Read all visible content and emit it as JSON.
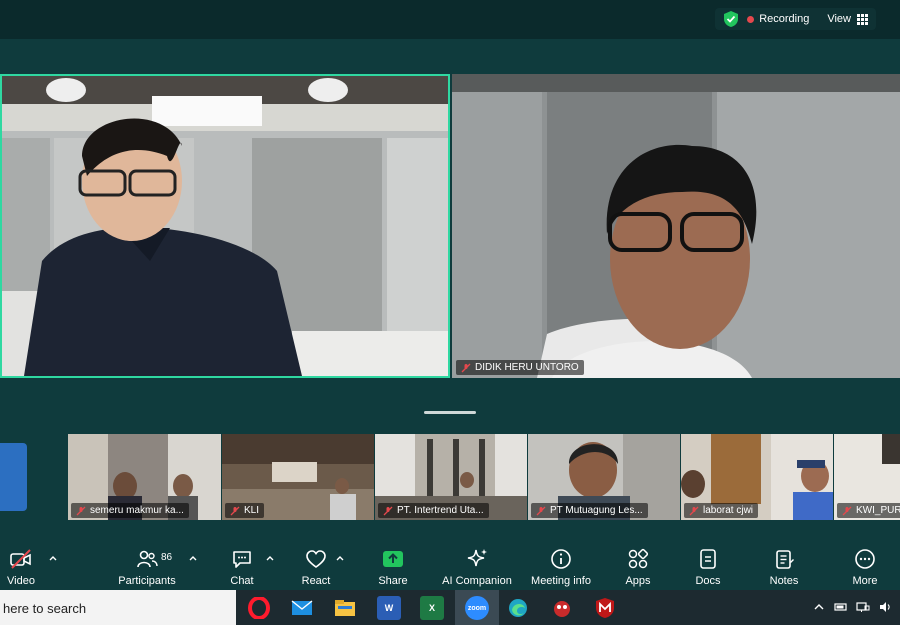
{
  "top_bar": {
    "recording_label": "Recording",
    "view_label": "View",
    "icons": [
      "shield-check-icon",
      "record-dot-icon",
      "grid-view-icon"
    ]
  },
  "main_tiles": [
    {
      "id": "left",
      "name": "",
      "active_speaker": true
    },
    {
      "id": "right",
      "name": "DIDIK HERU UNTORO",
      "muted": true
    }
  ],
  "thumbnails": [
    {
      "name": "semeru makmur ka..."
    },
    {
      "name": "KLI"
    },
    {
      "name": "PT. Intertrend Uta..."
    },
    {
      "name": "PT Mutuagung Les..."
    },
    {
      "name": "laborat cjwi"
    },
    {
      "name": "KWI_PURV"
    }
  ],
  "toolbar": {
    "video": "Video",
    "participants": "Participants",
    "participants_count": "86",
    "chat": "Chat",
    "react": "React",
    "share": "Share",
    "ai_companion": "AI Companion",
    "meeting_info": "Meeting info",
    "apps": "Apps",
    "docs": "Docs",
    "notes": "Notes",
    "more": "More"
  },
  "taskbar": {
    "search_placeholder": "here to search",
    "apps": [
      "opera-icon",
      "mail-icon",
      "file-explorer-icon",
      "word-icon",
      "excel-icon",
      "zoom-icon",
      "edge-icon",
      "game-icon",
      "mcafee-icon"
    ]
  },
  "colors": {
    "background": "#0f3b3d",
    "active_speaker_border": "#2fd8a1",
    "recording": "#e5484d",
    "share": "#22c55e"
  }
}
